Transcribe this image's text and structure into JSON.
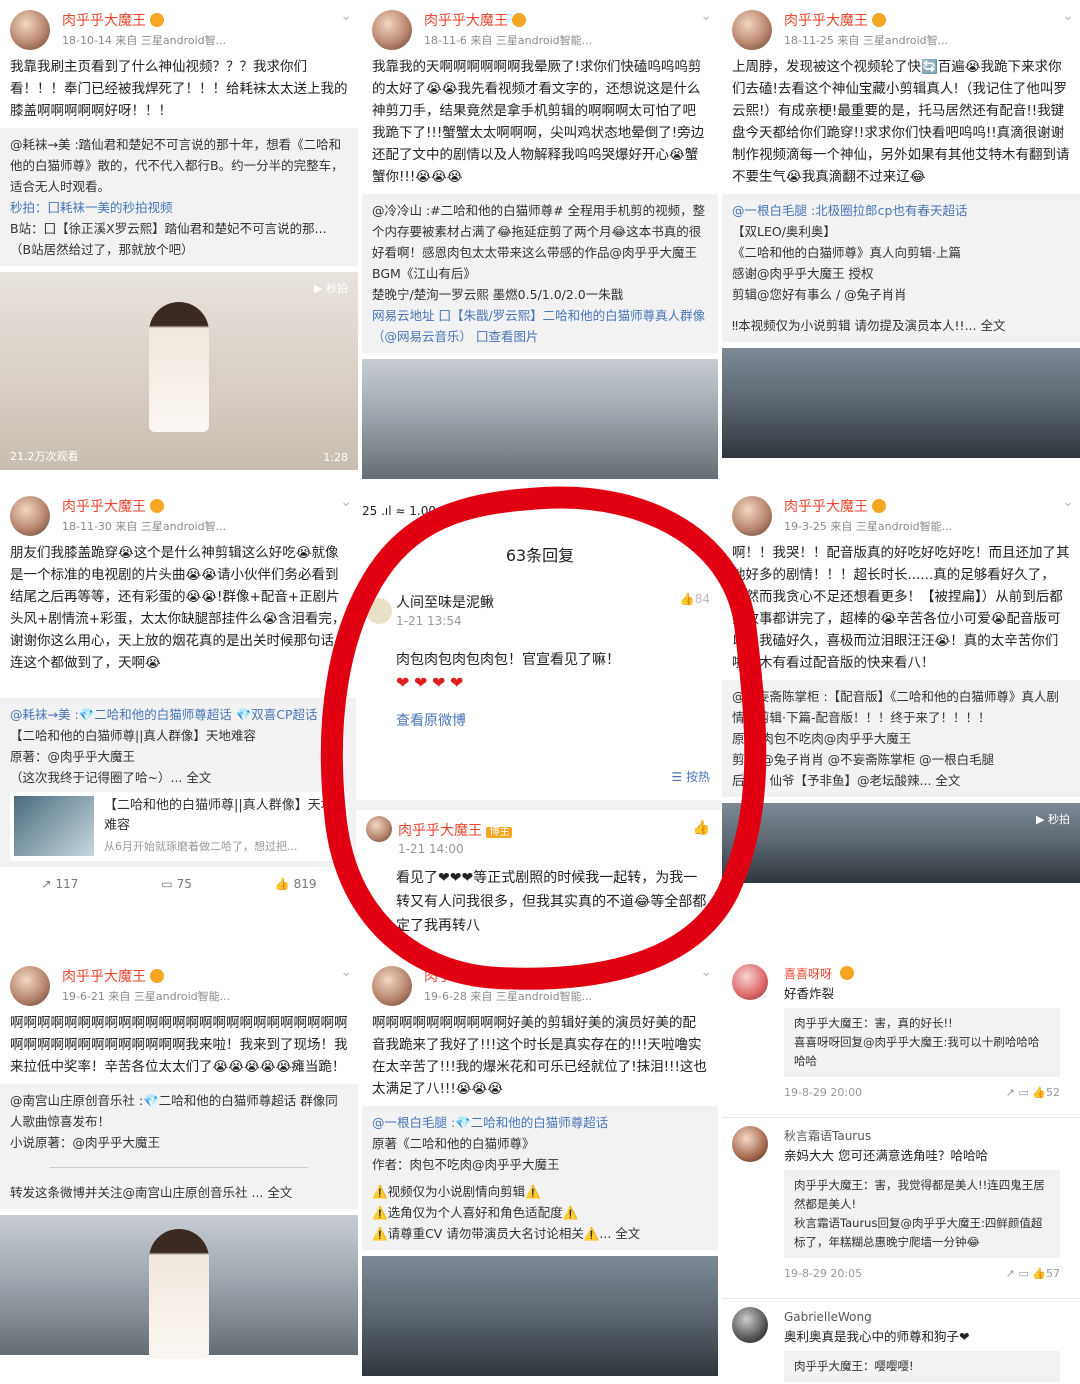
{
  "cards": {
    "c1": {
      "name": "肉乎乎大魔王",
      "meta": "18-10-14  来自 三星android智...",
      "text": "我靠我刷主页看到了什么神仙视频？？？我求你们看！！！奉门已经被我焊死了！！！给耗袜太太送上我的膝盖啊啊啊啊啊好呀！！！",
      "rt1": "@耗袜→美 :踏仙君和楚妃不可言说的那十年，想看《二哈和他的白猫师尊》散的，代不代入都行B。约一分半的完整车，适合无人时观看。",
      "rt2": "秒拍：囗耗袜一美的秒拍视频",
      "rt3": "B站：囗【徐正溪X罗云熙】踏仙君和楚妃不可言说的那... （B站居然给过了，那就放个吧）",
      "play": "秒拍",
      "views": "21.2万次观看",
      "dur": "1:28"
    },
    "c2": {
      "name": "肉乎乎大魔王",
      "meta": "18-11-6  来自 三星android智能...",
      "text": "我靠我的天啊啊啊啊啊啊我晕厥了!求你们快磕呜呜呜剪的太好了😭😭我先看视频才看文字的，还想说这是什么神剪刀手，结果竟然是拿手机剪辑的啊啊啊太可怕了吧我跪下了!!!蟹蟹太太啊啊啊，尖叫鸡状态地晕倒了!旁边还配了文中的剧情以及人物解释我呜呜哭爆好开心😭蟹蟹你!!!😭😭😭",
      "rt": "@冷冷山 :#二哈和他的白猫师尊# 全程用手机剪的视频，整个内存要被素材占满了😂拖延症剪了两个月😂这本书真的很好看啊！感恩肉包太太带来这么带感的作品@肉乎乎大魔王",
      "bgm": "BGM《江山有后》",
      "cast": "楚晚宁/楚洵一罗云熙  墨燃0.5/1.0/2.0一朱戬",
      "link": "网易云地址 囗【朱戬/罗云熙】二哈和他的白猫师尊真人群像（@网易云音乐） 囗查看图片"
    },
    "c3": {
      "name": "肉乎乎大魔王",
      "meta": "18-11-25  来自 三星android智...",
      "text": "上周脖，发现被这个视频轮了快🔄百遍😭我跪下来求你们去磕!去看这个神仙宝藏小剪辑真人!（我记住了他叫罗云熙!）有成亲梗!最重要的是，托马居然还有配音!!我键盘今天都给你们跪穿!!求求你们快看吧呜呜!!真滴很谢谢制作视频滴每一个神仙，另外如果有其他艾特木有翻到请不要生气😭我真滴翻不过来辽😂",
      "rt1": "@一根白毛腿 :北极圈拉郎cp也有春天超话",
      "rt2": "【双LEO/奥利奥】",
      "rt3": "《二哈和他的白猫师尊》真人向剪辑·上篇",
      "rt4": "感谢@肉乎乎大魔王 授权",
      "rt5": "剪辑@您好有事么 / @兔子肖肖",
      "warn": "‼本视频仅为小说剪辑 请勿提及演员本人!!... 全文"
    },
    "c4": {
      "name": "肉乎乎大魔王",
      "meta": "18-11-30  来自 三星android智...",
      "text": "朋友们我膝盖跪穿😭这个是什么神剪辑这么好吃😭就像是一个标准的电视剧的片头曲😭😭请小伙伴们务必看到结尾之后再等等，还有彩蛋的😭😭!群像+配音+正剧片头风+剧情流+彩蛋，太太你缺腿部挂件么😭含泪看完，谢谢你这么用心，天上放的烟花真的是出关时候那句话，连这个都做到了，天啊😭",
      "rt1": "@耗袜→美 :💎二哈和他的白猫师尊超话 💎双喜CP超话",
      "rt2": "【二哈和他的白猫师尊||真人群像】天地难容",
      "rt3": "原著：@肉乎乎大魔王",
      "rt4": "（这次我终于记得圈了哈~）... 全文",
      "linkTitle": "【二哈和他的白猫师尊||真人群像】天地难容",
      "linkSub": "从6月开始就琢磨着做二哈了，想过把...",
      "shares": "117",
      "comments": "75",
      "likes": "819"
    },
    "c5": {
      "name": "肉乎乎大魔王",
      "meta": "19-3-25  来自 三星android智能...",
      "text": "啊！！我哭！！配音版真的好吃好吃好吃！而且还加了其他好多的剧情！！！超长时长......真的足够看好久了，（然而我贪心不足还想看更多！【被捏扁】）从前到后都把故事都讲完了，超棒的😭辛苦各位小可爱😭配音版可以让我磕好久，喜极而泣泪眼汪汪😭！真的太辛苦你们啦！木有看过配音版的快来看八！",
      "rt1": "@不妄斋陈掌柜 :【配音版】《二哈和他的白猫师尊》真人剧情向剪辑·下篇-配音版！！！终于来了！！！！",
      "rt2": "原著/肉包不吃肉@肉乎乎大魔王",
      "rt3": "剪辑/@兔子肖肖 @不妄斋陈掌柜 @一根白毛腿",
      "rt4": "后期：仙爷【予非鱼】@老坛酸辣... 全文",
      "play": "秒拍"
    },
    "c6": {
      "name": "肉乎乎大魔王",
      "meta": "19-6-21  来自 三星android智能...",
      "text": "啊啊啊啊啊啊啊啊啊啊啊啊啊啊啊啊啊啊啊啊啊啊啊啊啊啊啊啊啊啊啊啊啊啊啊啊啊啊我来啦！我来到了现场！我来拉低中奖率！辛苦各位太太们了😭😭😭😭😭瘫当跪！",
      "rt1": "@南宫山庄原创音乐社 :💎二哈和他的白猫师尊超话 群像同人歌曲惊喜发布！",
      "rt2": "小说原著：@肉乎乎大魔王",
      "rt3": "转发这条微博并关注@南宫山庄原创音乐社 ... 全文"
    },
    "c7": {
      "name": "肉乎乎大魔王",
      "meta": "19-6-28  来自 三星android智能...",
      "text": "啊啊啊啊啊啊啊啊啊啊好美的剪辑好美的演员好美的配音我跪来了我好了!!!这个时长是真实存在的!!!天啦噜实在太辛苦了!!!我的爆米花和可乐已经就位了!抹泪!!!这也太满足了八!!!😭😭😭",
      "rt1": "@一根白毛腿 :💎二哈和他的白猫师尊超话",
      "rt2": "原著《二哈和他的白猫师尊》",
      "rt3": "作者：肉包不吃肉@肉乎乎大魔王",
      "w1": "⚠️视频仅为小说剧情向剪辑⚠️",
      "w2": "⚠️选角仅为个人喜好和角色适配度⚠️",
      "w3": "⚠️请尊重CV 请勿带演员大名讨论相关⚠️... 全文"
    },
    "c8": {
      "user1": "喜喜呀呀",
      "cmt1": "好香炸裂",
      "sub1a": "肉乎乎大魔王：害，真的好长!!",
      "sub1b": "喜喜呀呀回复@肉乎乎大魔王:我可以十刷哈哈哈哈哈",
      "date1": "19-8-29 20:00",
      "likes1": "52",
      "user2": "秋言霜语Taurus",
      "cmt2": "亲妈大大 您可还满意选角哇？哈哈哈",
      "sub2a": "肉乎乎大魔王：害，我觉得都是美人!!连四鬼王居然都是美人!",
      "sub2b": "秋言霜语Taurus回复@肉乎乎大魔王:四鲜颜值超标了，年糕糊总惠晚宁爬墙一分钟😂",
      "date2": "19-8-29 20:05",
      "likes2": "57",
      "user3": "GabrielleWong",
      "cmt3": "奥利奥真是我心中的师尊和狗子❤",
      "sub3": "肉乎乎大魔王：嘤嘤嘤!"
    }
  },
  "popup": {
    "status": "25 .ıl ≈ 1.00 KB/S HD",
    "title": "63条回复",
    "r1": {
      "user": "人间至味是泥鳅",
      "date": "1-21 13:54",
      "text": "肉包肉包肉包肉包！官宣看见了嘛！",
      "count": "84",
      "link": "查看原微博",
      "sort": "按热"
    },
    "r2": {
      "user": "肉乎乎大魔王",
      "badge": "博主",
      "date": "1-21 14:00",
      "text": "看见了❤❤❤等正式剧照的时候我一起转，为我一转又有人问我很多，但我其实真的不道😂等全部都定了我再转八"
    }
  },
  "colors": {
    "accent": "#e8462f",
    "link": "#4a76b8",
    "circle": "#e00012"
  }
}
